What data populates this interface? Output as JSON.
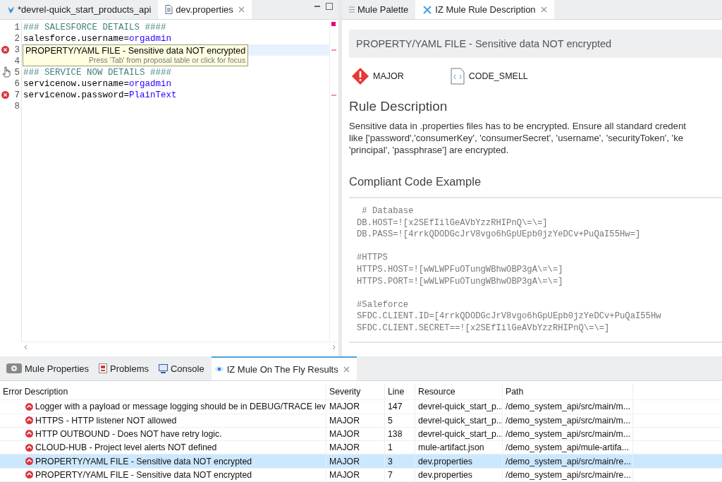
{
  "editor": {
    "tabs": [
      {
        "label": "*devrel-quick_start_products_api",
        "selected": false,
        "kind": "mule"
      },
      {
        "label": "dev.properties",
        "selected": true,
        "kind": "file"
      }
    ],
    "lines": [
      {
        "number": "1",
        "kind": "comment",
        "text": "### SALESFORCE DETAILS ####",
        "error": false,
        "highlighted": false
      },
      {
        "number": "2",
        "kind": "property",
        "key": "salesforce.username=",
        "value": "orgadmin",
        "error": false,
        "highlighted": false
      },
      {
        "number": "3",
        "kind": "hidden",
        "error": true,
        "highlighted": true
      },
      {
        "number": "4",
        "kind": "hidden",
        "error": false,
        "highlighted": false
      },
      {
        "number": "5",
        "kind": "comment",
        "text": "### SERVICE NOW DETAILS ####",
        "error": false,
        "highlighted": false
      },
      {
        "number": "6",
        "kind": "property",
        "key": "servicenow.username=",
        "value": "orgadmin",
        "error": false,
        "highlighted": false
      },
      {
        "number": "7",
        "kind": "property",
        "key": "servicenow.password=",
        "value": "PlainText",
        "error": true,
        "highlighted": false
      },
      {
        "number": "8",
        "kind": "empty",
        "error": false,
        "highlighted": false
      }
    ],
    "tooltip": {
      "title": "PROPERTY/YAML FILE - Sensitive data NOT encrypted",
      "hint": "Press 'Tab' from proposal table or click for focus"
    }
  },
  "rule_panel": {
    "tabs": [
      {
        "label": "Mule Palette",
        "selected": false,
        "kind": "palette"
      },
      {
        "label": "IZ Mule Rule Description",
        "selected": true,
        "kind": "tools"
      }
    ],
    "title": "PROPERTY/YAML FILE - Sensitive data NOT encrypted",
    "severity": "MAJOR",
    "type": "CODE_SMELL",
    "description_heading": "Rule Description",
    "description_lines": [
      "Sensitive data in .properties files has to be encrypted. Ensure all standard credent",
      "like ['password','consumerKey', 'consumerSecret', 'username', 'securityToken', 'ke",
      "'principal', 'passphrase'] are encrypted."
    ],
    "example_heading": "Compliant Code Example",
    "example_code": [
      [
        " # Database",
        "DB.HOST=![x2SEfIilGeAVbYzzRHIPnQ\\=\\=]",
        "DB.PASS=![4rrkQDODGcJrV8vgo6hGpUEpb0jzYeDCv+PuQaI55Hw=]"
      ],
      [
        "#HTTPS",
        "HTTPS.HOST=![wWLWPFuOTungWBhwOBP3gA\\=\\=]",
        "HTTPS.PORT=![wWLWPFuOTungWBhwOBP3gA\\=\\=]"
      ],
      [
        "#Saleforce",
        "SFDC.CLIENT.ID=[4rrkQDODGcJrV8vgo6hGpUEpb0jzYeDCv+PuQaI55Hw",
        "SFDC.CLIENT.SECRET==![x2SEfIilGeAVbYzzRHIPnQ\\=\\=]"
      ]
    ]
  },
  "results_panel": {
    "tabs": [
      {
        "label": "Mule Properties",
        "selected": false,
        "kind": "gear"
      },
      {
        "label": "Problems",
        "selected": false,
        "kind": "problems"
      },
      {
        "label": "Console",
        "selected": false,
        "kind": "console"
      },
      {
        "label": "IZ Mule On The Fly Results",
        "selected": true,
        "kind": "eye"
      }
    ],
    "table": {
      "columns": [
        "Error Description",
        "Severity",
        "Line",
        "Resource",
        "Path"
      ],
      "rows": [
        {
          "description": "Logger with a payload or message logging should be in DEBUG/TRACE lev",
          "severity": "MAJOR",
          "line": "147",
          "resource": "devrel-quick_start_p...",
          "path": "/demo_system_api/src/main/m...",
          "selected": false
        },
        {
          "description": "HTTPS - HTTP listener NOT allowed",
          "severity": "MAJOR",
          "line": "5",
          "resource": "devrel-quick_start_p...",
          "path": "/demo_system_api/src/main/m...",
          "selected": false
        },
        {
          "description": "HTTP OUTBOUND - Does NOT have retry logic.",
          "severity": "MAJOR",
          "line": "138",
          "resource": "devrel-quick_start_p...",
          "path": "/demo_system_api/src/main/m...",
          "selected": false
        },
        {
          "description": "CLOUD-HUB - Project level alerts NOT defined",
          "severity": "MAJOR",
          "line": "1",
          "resource": "mule-artifact.json",
          "path": "/demo_system_api/mule-artifa...",
          "selected": false
        },
        {
          "description": "PROPERTY/YAML FILE - Sensitive data NOT encrypted",
          "severity": "MAJOR",
          "line": "3",
          "resource": "dev.properties",
          "path": "/demo_system_api/src/main/re...",
          "selected": true
        },
        {
          "description": "PROPERTY/YAML FILE - Sensitive data NOT encrypted",
          "severity": "MAJOR",
          "line": "7",
          "resource": "dev.properties",
          "path": "/demo_system_api/src/main/re...",
          "selected": false
        }
      ]
    }
  }
}
